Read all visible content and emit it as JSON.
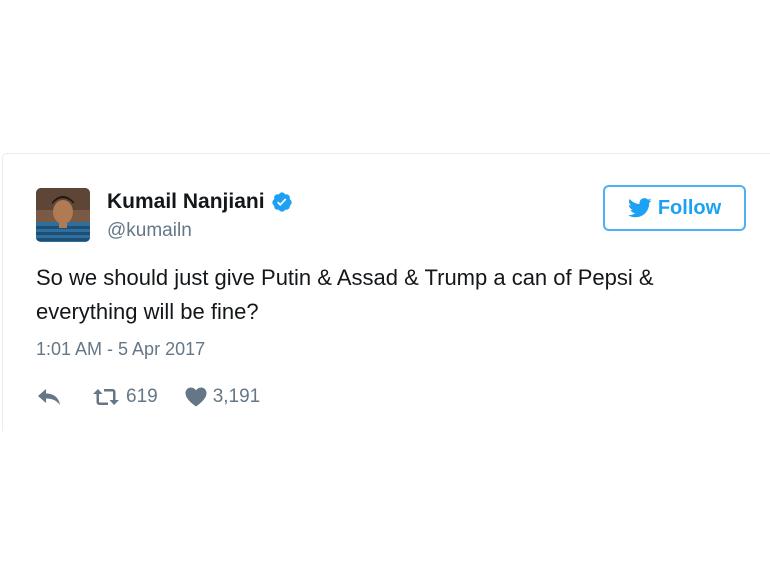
{
  "tweet": {
    "author": {
      "display_name": "Kumail Nanjiani",
      "handle": "@kumailn",
      "verified": true
    },
    "follow_button": {
      "label": "Follow",
      "icon": "twitter-bird-icon"
    },
    "text": "So we should just give Putin & Assad & Trump a can of Pepsi &\neverything will be fine?",
    "timestamp": "1:01 AM - 5 Apr 2017",
    "actions": {
      "reply": {
        "icon": "reply-icon"
      },
      "retweet": {
        "icon": "retweet-icon",
        "count": "619"
      },
      "like": {
        "icon": "heart-icon",
        "count": "3,191"
      }
    }
  },
  "colors": {
    "twitter_blue": "#1da1f2",
    "secondary_text": "#657786",
    "primary_text": "#14171a",
    "border": "#e6ecf0"
  }
}
